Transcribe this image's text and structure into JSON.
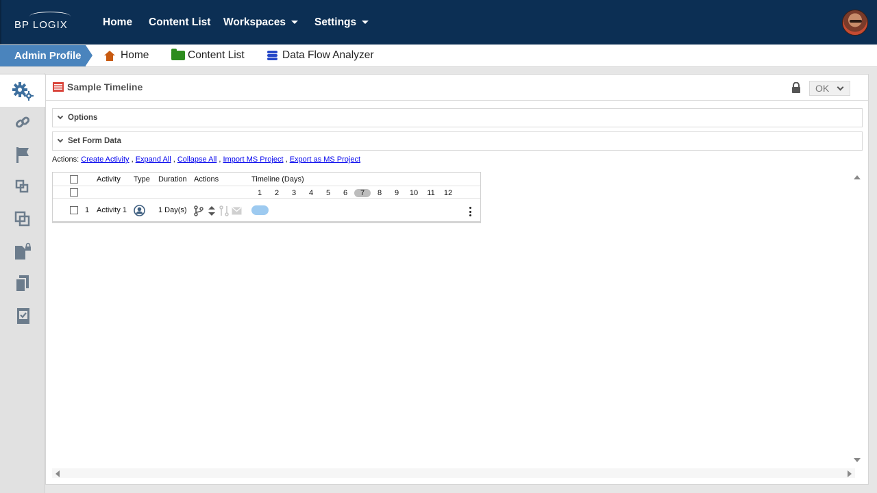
{
  "topnav": {
    "logo": "BP LOGIX",
    "items": [
      {
        "label": "Home",
        "has_menu": false
      },
      {
        "label": "Content List",
        "has_menu": false
      },
      {
        "label": "Workspaces",
        "has_menu": true
      },
      {
        "label": "Settings",
        "has_menu": true
      }
    ]
  },
  "breadcrumb": {
    "profile": "Admin Profile",
    "items": [
      {
        "label": "Home",
        "icon": "home-icon",
        "color": "#c85a10"
      },
      {
        "label": "Content List",
        "icon": "folder-icon",
        "color": "#2d8c1e"
      },
      {
        "label": "Data Flow Analyzer",
        "icon": "database-icon",
        "color": "#2547c8"
      }
    ]
  },
  "sidebar": {
    "items": [
      {
        "icon": "gears-icon",
        "active": true
      },
      {
        "icon": "link-icon",
        "active": false
      },
      {
        "icon": "flag-icon",
        "active": false
      },
      {
        "icon": "layers-icon",
        "active": false
      },
      {
        "icon": "copy-icon",
        "active": false
      },
      {
        "icon": "locked-document-icon",
        "active": false
      },
      {
        "icon": "documents-icon",
        "active": false
      },
      {
        "icon": "checked-document-icon",
        "active": false
      }
    ],
    "accent_color": "#3d6f9e"
  },
  "panel": {
    "title": "Sample Timeline",
    "ok_label": "OK",
    "sections": [
      "Options",
      "Set Form Data"
    ],
    "actions_prefix": "Actions:",
    "actions": [
      "Create Activity",
      "Expand All",
      "Collapse All",
      "Import MS Project",
      "Export as MS Project"
    ]
  },
  "grid": {
    "headers": {
      "activity": "Activity",
      "type": "Type",
      "duration": "Duration",
      "actions": "Actions",
      "timeline": "Timeline (Days)"
    },
    "days": [
      "1",
      "2",
      "3",
      "4",
      "5",
      "6",
      "7",
      "8",
      "9",
      "10",
      "11",
      "12"
    ],
    "today": "7",
    "rows": [
      {
        "num": "1",
        "activity": "Activity 1",
        "type_icon": "user-icon",
        "duration": "1 Day(s)",
        "start_day": 1,
        "length_days": 1
      }
    ],
    "bar_color": "#9dcaf0"
  }
}
